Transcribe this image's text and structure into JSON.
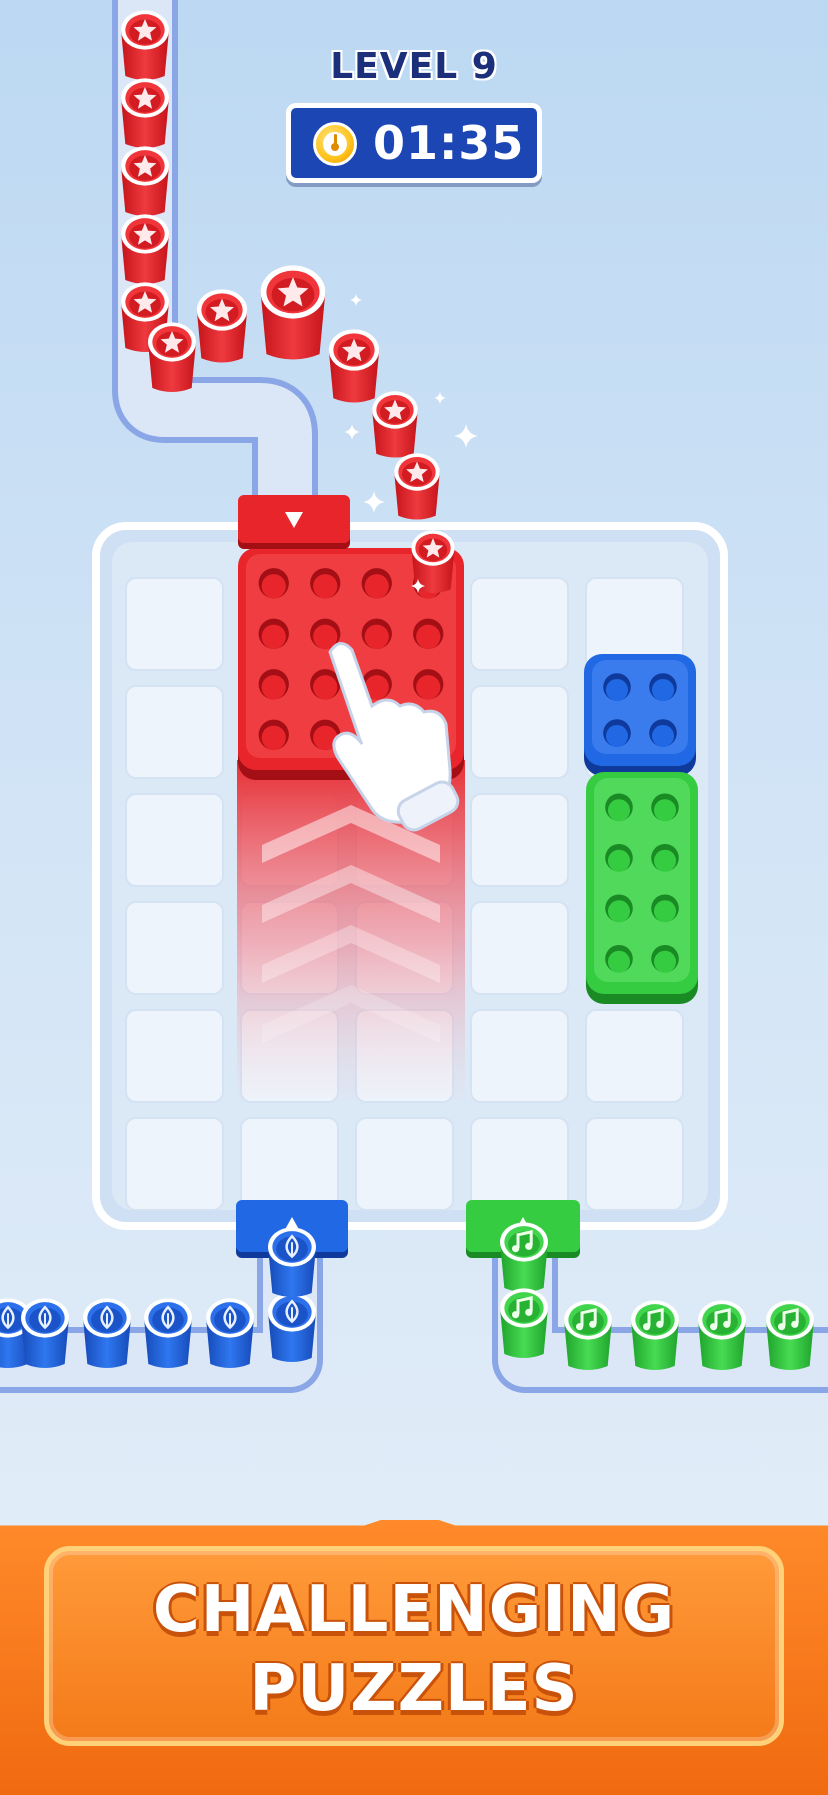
{
  "header": {
    "level_label": "LEVEL 9",
    "timer_text": "01:35",
    "timer_icon": "stopwatch-icon"
  },
  "board": {
    "columns": 5,
    "rows": 6,
    "blocks": [
      {
        "color": "red",
        "pegs_wide": 4,
        "pegs_tall": 4
      },
      {
        "color": "blue",
        "pegs_wide": 2,
        "pegs_tall": 2
      },
      {
        "color": "green",
        "pegs_wide": 2,
        "pegs_tall": 4
      }
    ]
  },
  "queues": {
    "red_cups": {
      "color": "red",
      "symbol": "star"
    },
    "blue_cups": {
      "color": "blue",
      "symbol": "leaf"
    },
    "green_cups": {
      "color": "green",
      "symbol": "music-note"
    }
  },
  "hint": {
    "icon": "pointing-hand-icon"
  },
  "banner": {
    "line1": "CHALLENGING",
    "line2": "PUZZLES"
  },
  "colors": {
    "red": "#e8252b",
    "blue": "#1f63de",
    "green": "#2fc93c",
    "orange": "#f47a18",
    "navy": "#1d46b5"
  }
}
